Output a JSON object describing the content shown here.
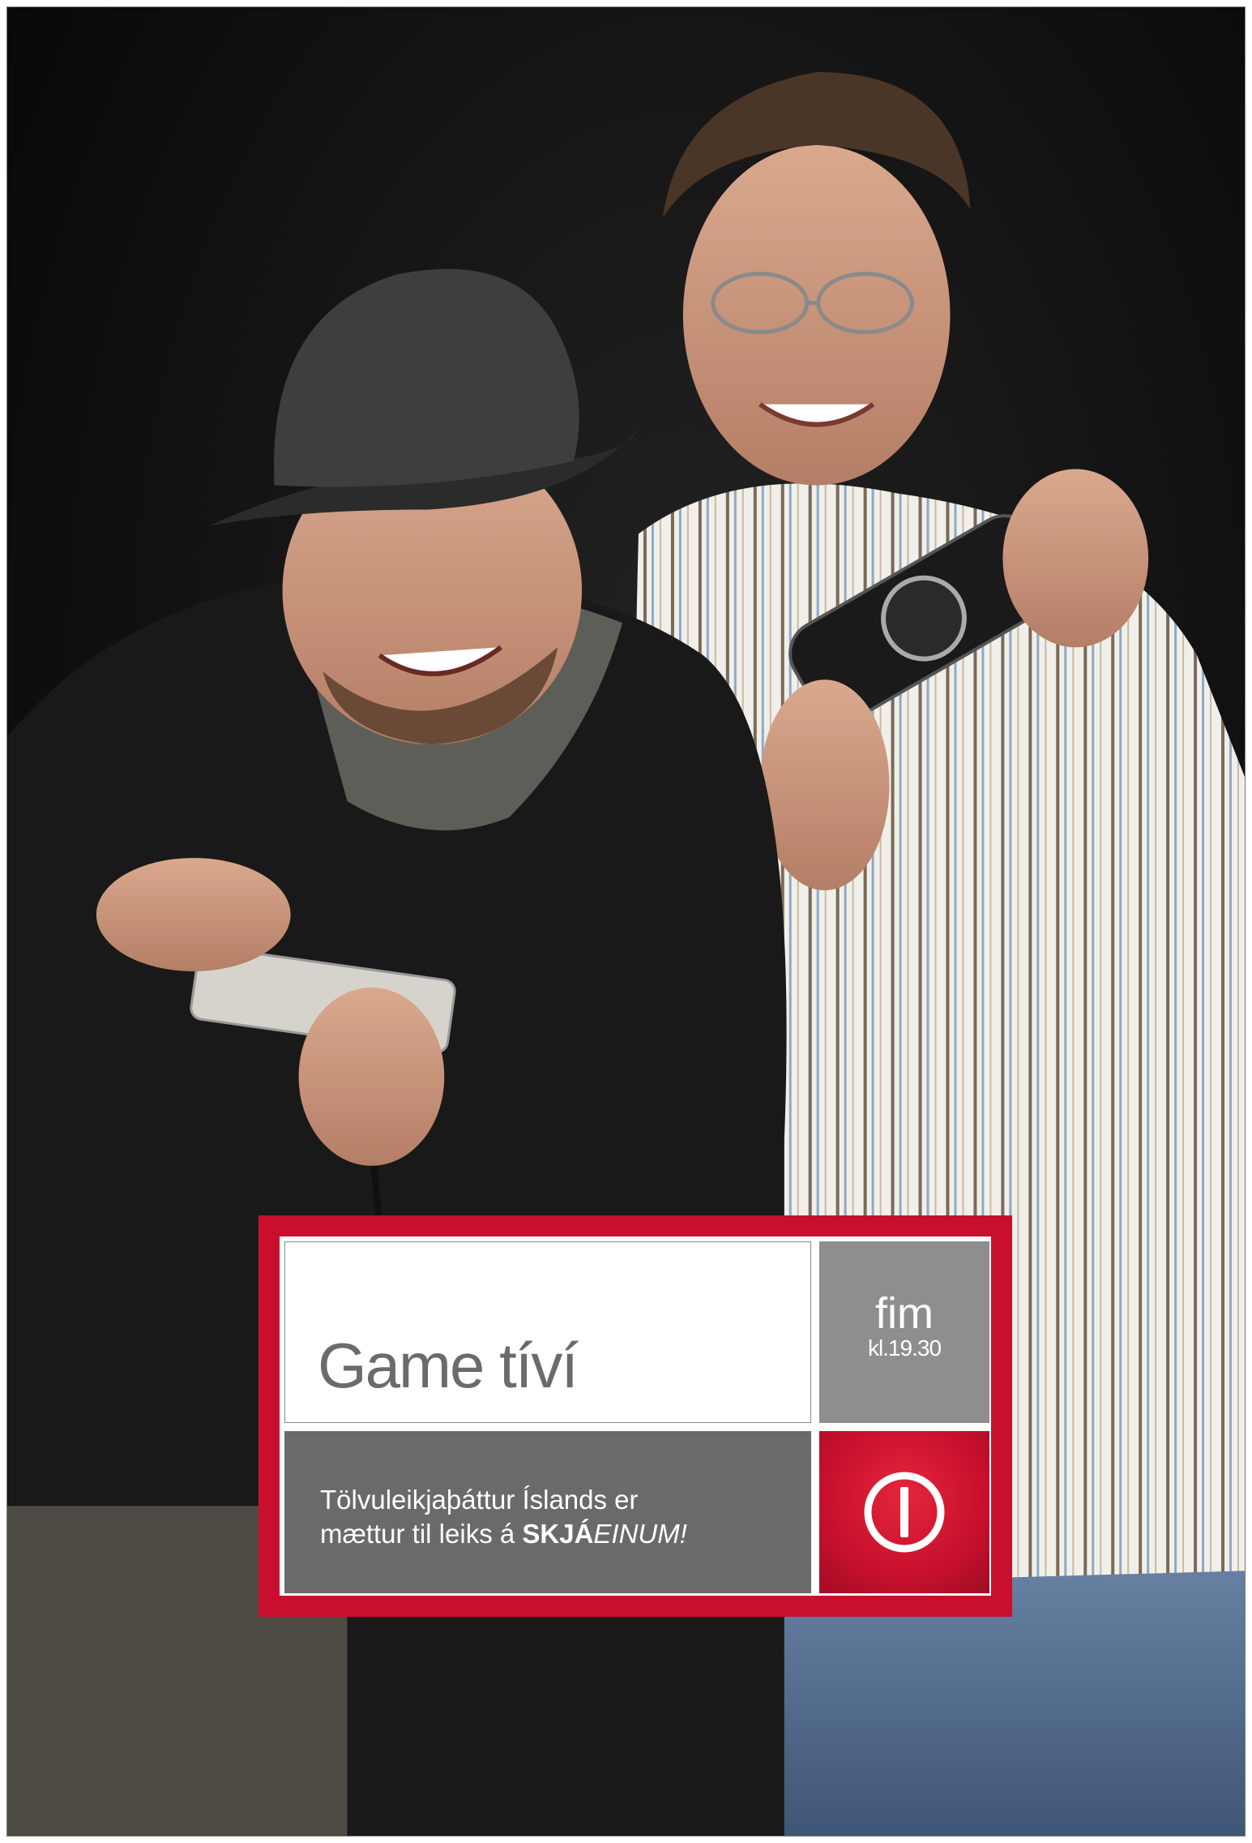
{
  "photo": {
    "subject": "two men holding game controllers",
    "background_color": "#0b0b0b"
  },
  "ad": {
    "frame_color": "#c8102e",
    "title": "Game tíví",
    "schedule": {
      "day": "fim",
      "time": "kl.19.30"
    },
    "description": {
      "line1": "Tölvuleikjaþáttur Íslands er",
      "line2_prefix": "mættur til leiks á ",
      "brand_bold": "SKJÁ",
      "brand_italic": "EINUM!"
    },
    "logo_icon": "power-logo-icon"
  }
}
